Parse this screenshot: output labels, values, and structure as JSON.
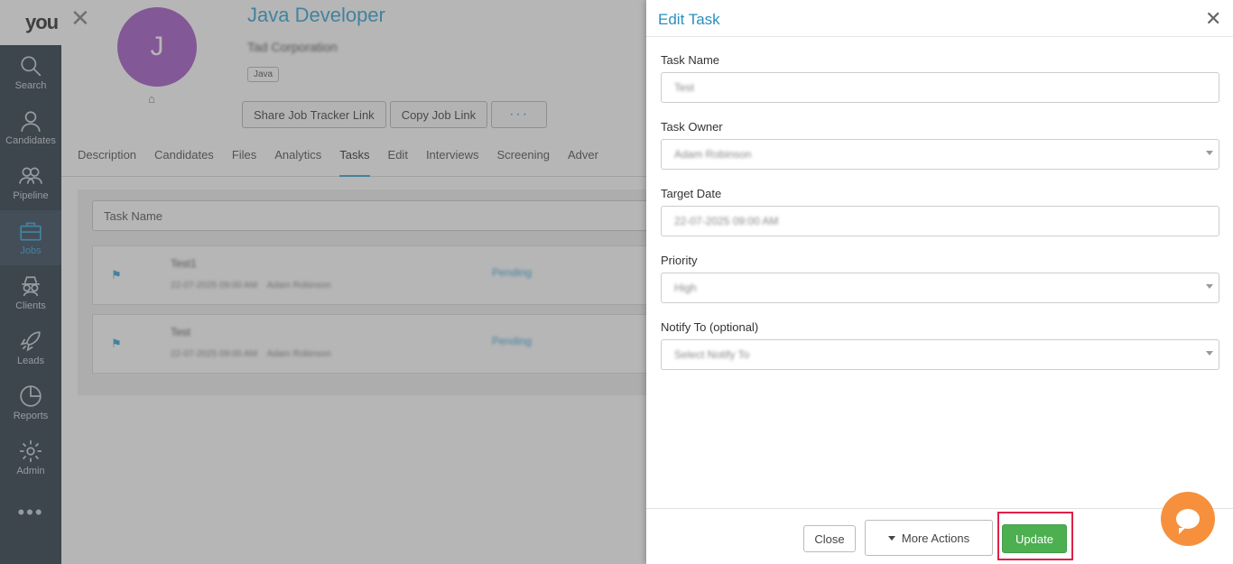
{
  "rail": {
    "brand": "you",
    "items": [
      {
        "label": "Search",
        "icon": "search-icon"
      },
      {
        "label": "Candidates",
        "icon": "user-icon"
      },
      {
        "label": "Pipeline",
        "icon": "users-icon"
      },
      {
        "label": "Jobs",
        "icon": "briefcase-icon"
      },
      {
        "label": "Clients",
        "icon": "spy-icon"
      },
      {
        "label": "Leads",
        "icon": "rocket-icon"
      },
      {
        "label": "Reports",
        "icon": "pie-chart-icon"
      },
      {
        "label": "Admin",
        "icon": "gear-icon"
      }
    ],
    "more": "•••"
  },
  "job": {
    "avatar_letter": "J",
    "title": "Java Developer",
    "company": "Tad Corporation",
    "skill": "Java",
    "buttons": {
      "share": "Share Job Tracker Link",
      "copy": "Copy Job Link",
      "more": "···"
    }
  },
  "tabs": [
    "Description",
    "Candidates",
    "Files",
    "Analytics",
    "Tasks",
    "Edit",
    "Interviews",
    "Screening",
    "Adver"
  ],
  "tasks": {
    "search_placeholder": "Task Name",
    "rows": [
      {
        "name": "Test1",
        "date": "22-07-2025 09:00 AM",
        "owner": "Adam Robinson",
        "status": "Pending"
      },
      {
        "name": "Test",
        "date": "22-07-2025 09:00 AM",
        "owner": "Adam Robinson",
        "status": "Pending"
      }
    ]
  },
  "panel": {
    "title": "Edit Task",
    "close": "✕",
    "fields": {
      "task_name": {
        "label": "Task Name",
        "value": "Test"
      },
      "task_owner": {
        "label": "Task Owner",
        "value": "Adam Robinson"
      },
      "target_date": {
        "label": "Target Date",
        "value": "22-07-2025 09:00 AM"
      },
      "priority": {
        "label": "Priority",
        "value": "High"
      },
      "notify_to": {
        "label": "Notify To (optional)",
        "value": "Select Notify To"
      }
    },
    "footer": {
      "close": "Close",
      "more_actions": "More Actions",
      "update": "Update"
    }
  },
  "colors": {
    "accent": "#2a8fbf",
    "update": "#4caf50",
    "highlight": "#e0204a",
    "chat": "#f6903d",
    "avatar": "#a85ec9"
  }
}
